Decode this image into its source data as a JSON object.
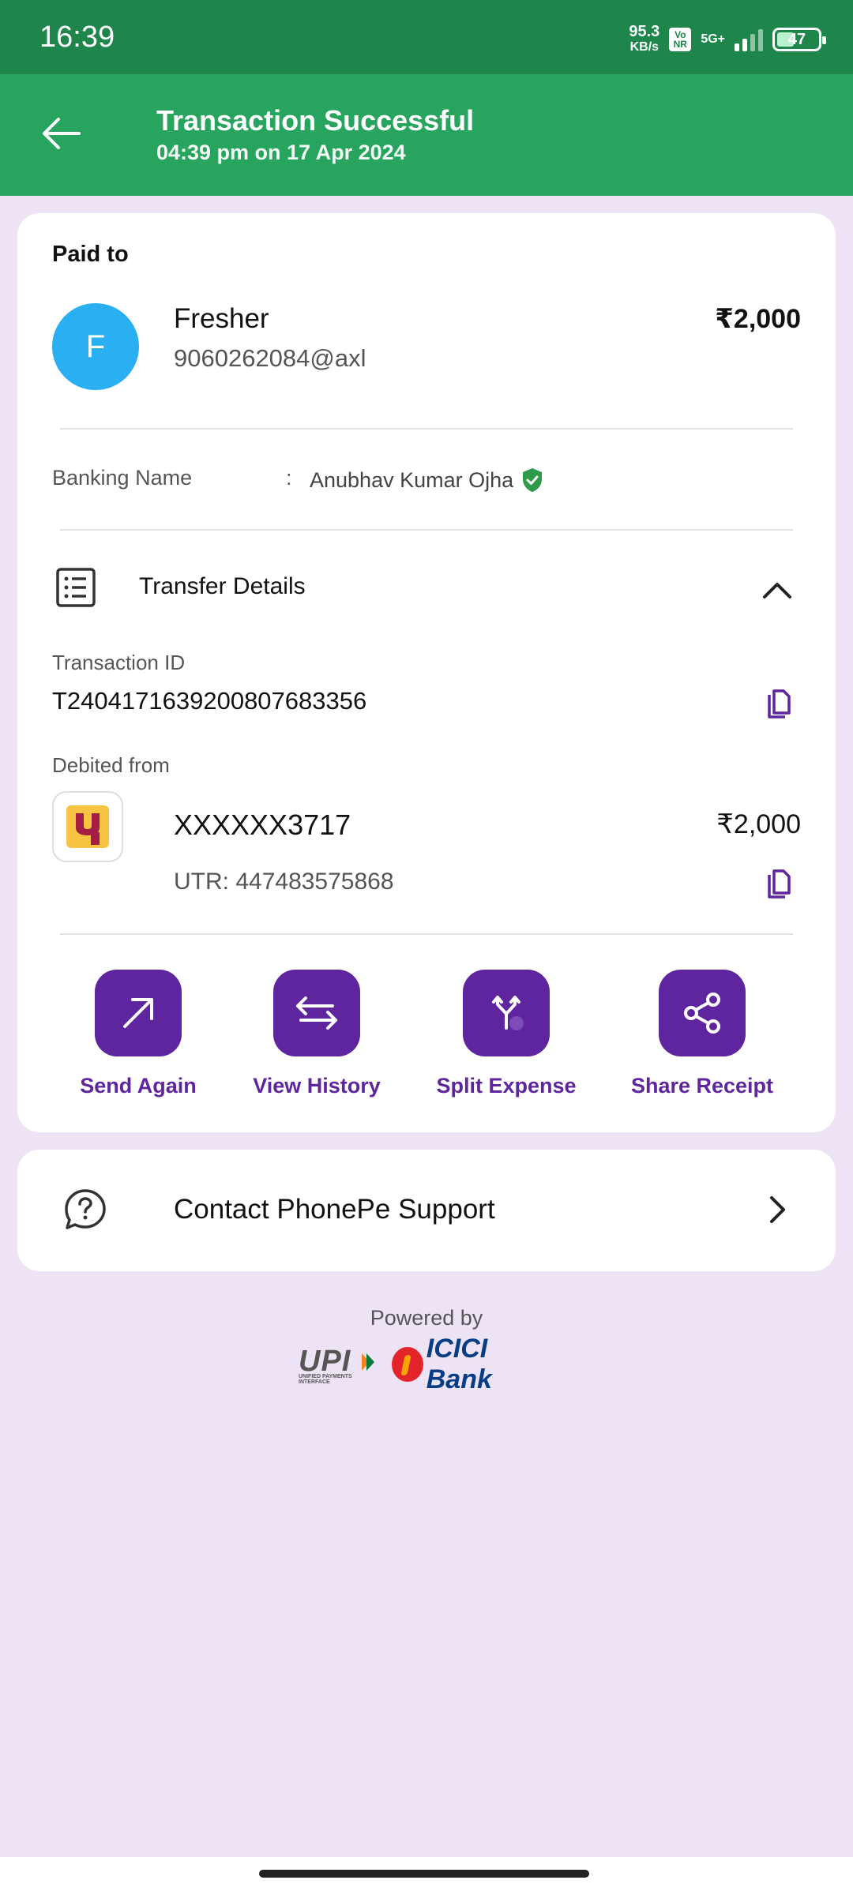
{
  "status_bar": {
    "time": "16:39",
    "speed_value": "95.3",
    "speed_unit": "KB/s",
    "volte_top": "Vo",
    "volte_bottom": "NR",
    "network": "5G+",
    "battery": "47"
  },
  "header": {
    "back_icon": "arrow-left-icon",
    "title": "Transaction Successful",
    "subtitle": "04:39 pm on 17 Apr 2024"
  },
  "payment": {
    "paid_to_label": "Paid to",
    "avatar_initial": "F",
    "payee_name": "Fresher",
    "payee_vpa": "9060262084@axl",
    "amount": "₹2,000",
    "banking_name_label": "Banking Name",
    "banking_name_colon": ":",
    "banking_name_value": "Anubhav Kumar Ojha"
  },
  "transfer_details": {
    "title": "Transfer Details",
    "transaction_id_label": "Transaction ID",
    "transaction_id": "T2404171639200807683356",
    "debited_from_label": "Debited from",
    "account": "XXXXXX3717",
    "amount": "₹2,000",
    "utr": "UTR: 447483575868"
  },
  "actions": [
    {
      "label": "Send Again",
      "icon": "arrow-up-right-icon"
    },
    {
      "label": "View History",
      "icon": "swap-arrows-icon"
    },
    {
      "label": "Split Expense",
      "icon": "split-icon"
    },
    {
      "label": "Share Receipt",
      "icon": "share-icon"
    }
  ],
  "support": {
    "label": "Contact PhonePe Support"
  },
  "footer": {
    "powered_by": "Powered by",
    "upi_logo_text": "UPI",
    "upi_logo_sub": "UNIFIED PAYMENTS INTERFACE",
    "bank_logo_text": "ICICI Bank"
  },
  "colors": {
    "header_green": "#27a55e",
    "status_green": "#1e864b",
    "accent_purple": "#5f259f",
    "avatar_blue": "#2ab0f2",
    "background": "#ede3f5"
  }
}
